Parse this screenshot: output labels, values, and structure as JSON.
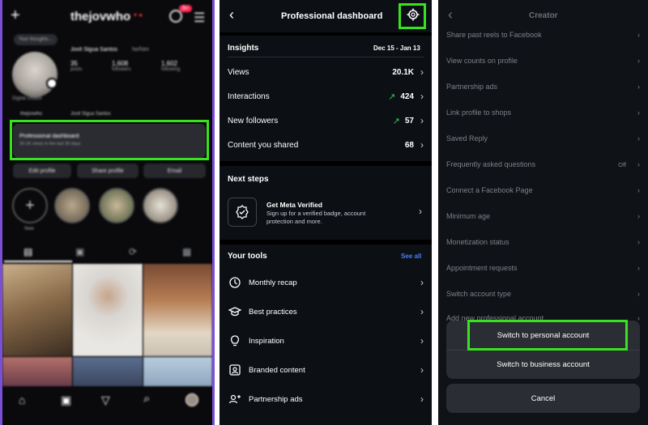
{
  "profile": {
    "username": "thejovwho",
    "notif_count": "9+",
    "display_name": "Jovit Sigua Santos",
    "pronoun": "he/him",
    "stats": [
      {
        "num": "35",
        "label": "posts"
      },
      {
        "num": "1,608",
        "label": "followers"
      },
      {
        "num": "1,602",
        "label": "following"
      }
    ],
    "bubble": "Your thoughts...",
    "category": "Digital creator",
    "handle_link": "thejovwho",
    "name_link": "Jovit Sigua Santos",
    "dashboard_title": "Professional dashboard",
    "dashboard_sub": "20.1K views in the last 30 days",
    "buttons": [
      "Edit profile",
      "Share profile",
      "Email"
    ],
    "new_label": "New"
  },
  "dashboard": {
    "title": "Professional dashboard",
    "insights_label": "Insights",
    "date_range": "Dec 15 - Jan 13",
    "insights": [
      {
        "label": "Views",
        "value": "20.1K",
        "trend": ""
      },
      {
        "label": "Interactions",
        "value": "424",
        "trend": "up"
      },
      {
        "label": "New followers",
        "value": "57",
        "trend": "up"
      },
      {
        "label": "Content you shared",
        "value": "68",
        "trend": ""
      }
    ],
    "next_steps_label": "Next steps",
    "meta_title": "Get Meta Verified",
    "meta_desc": "Sign up for a verified badge, account protection and more.",
    "tools_label": "Your tools",
    "see_all": "See all",
    "tools": [
      {
        "label": "Monthly recap",
        "icon": "recap-icon"
      },
      {
        "label": "Best practices",
        "icon": "graduation-cap-icon"
      },
      {
        "label": "Inspiration",
        "icon": "lightbulb-icon"
      },
      {
        "label": "Branded content",
        "icon": "branded-content-icon"
      },
      {
        "label": "Partnership ads",
        "icon": "partnership-icon"
      }
    ]
  },
  "creator": {
    "title": "Creator",
    "rows": [
      {
        "label": "Share past reels to Facebook",
        "value": ""
      },
      {
        "label": "View counts on profile",
        "value": ""
      },
      {
        "label": "Partnership ads",
        "value": ""
      },
      {
        "label": "Link profile to shops",
        "value": ""
      },
      {
        "label": "Saved Reply",
        "value": ""
      },
      {
        "label": "Frequently asked questions",
        "value": "Off"
      },
      {
        "label": "Connect a Facebook Page",
        "value": ""
      },
      {
        "label": "Minimum age",
        "value": ""
      },
      {
        "label": "Monetization status",
        "value": ""
      },
      {
        "label": "Appointment requests",
        "value": ""
      },
      {
        "label": "Switch account type",
        "value": ""
      },
      {
        "label": "Add new professional account",
        "value": ""
      }
    ],
    "switch_personal": "Switch to personal account",
    "switch_business": "Switch to business account",
    "cancel": "Cancel"
  },
  "colors": {
    "highlight": "#39e21f",
    "accent_blue": "#4d7cff",
    "trend_green": "#35c759"
  }
}
